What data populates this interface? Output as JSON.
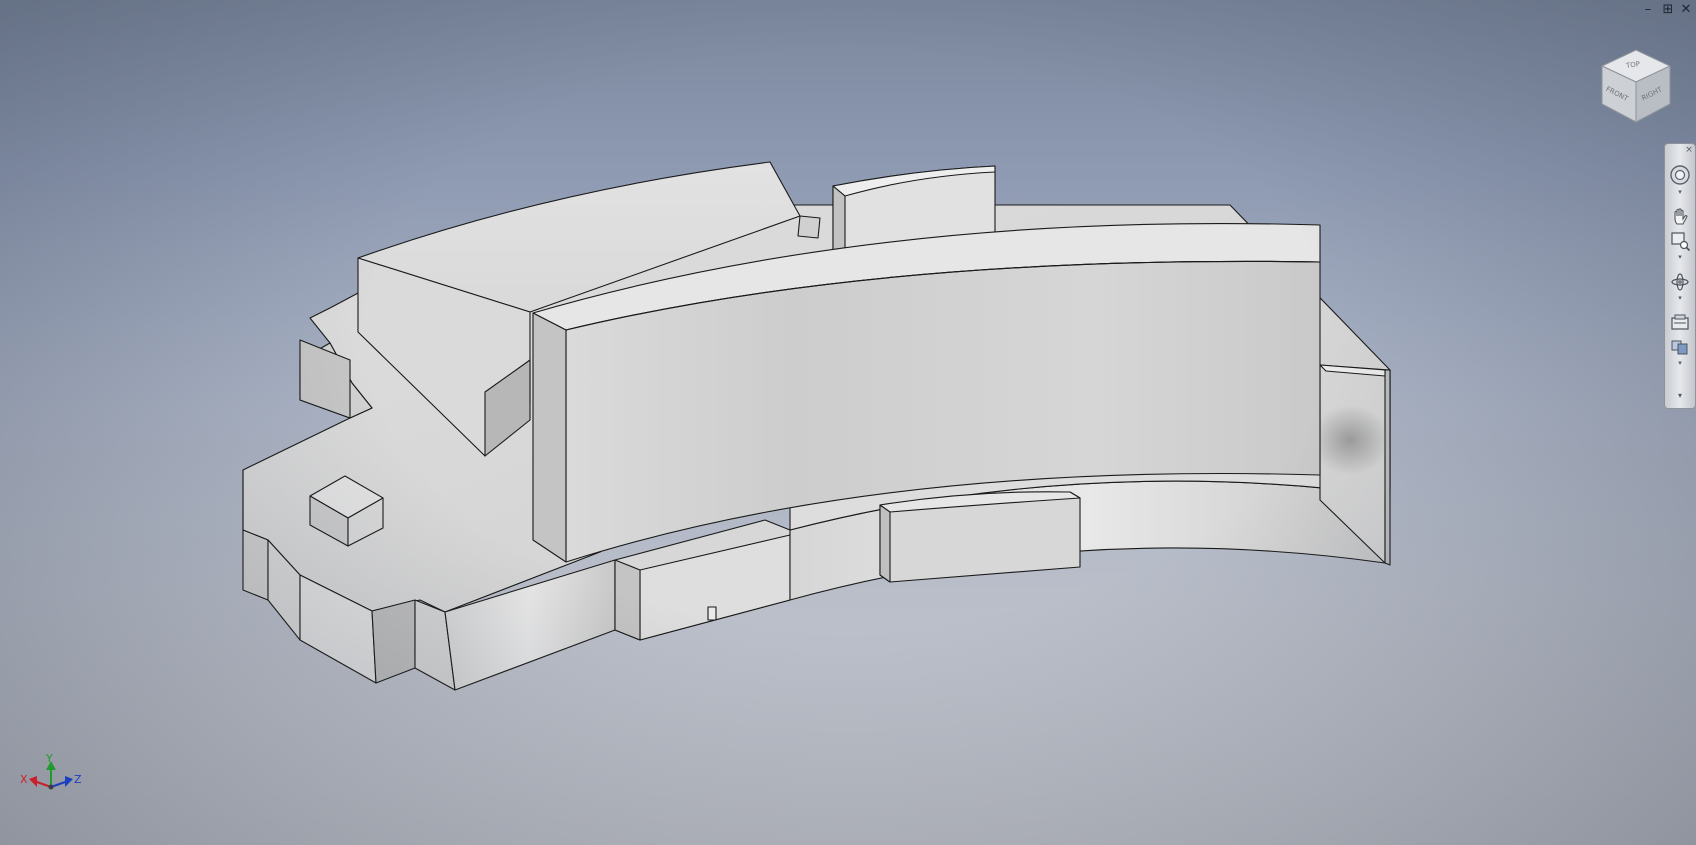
{
  "window_controls": {
    "minimize_glyph": "–",
    "restore_glyph": "⊞",
    "close_glyph": "✕"
  },
  "viewcube": {
    "top_face_label": "TOP",
    "front_face_label": "FRONT",
    "right_face_label": "RIGHT"
  },
  "navbar": {
    "close_glyph": "×",
    "items": [
      {
        "icon": "full-navigation-wheel-icon"
      },
      {
        "icon": "pan-hand-icon"
      },
      {
        "icon": "zoom-window-icon"
      },
      {
        "icon": "orbit-icon"
      },
      {
        "icon": "look-at-icon"
      },
      {
        "icon": "view-style-icon"
      }
    ],
    "dropdown_glyph": "▾"
  },
  "triad": {
    "x_label": "X",
    "y_label": "Y",
    "z_label": "Z",
    "x_color": "#c8202a",
    "y_color": "#1f9a2e",
    "z_color": "#1c3fbf"
  },
  "colors": {
    "background_top": "#7b879c",
    "background_bottom": "#c7c9cf",
    "model_face_light": "#e4e4e4",
    "model_face_mid": "#cfcfcf",
    "model_face_dark": "#a9a9a9",
    "edge": "#1a1a1a"
  }
}
